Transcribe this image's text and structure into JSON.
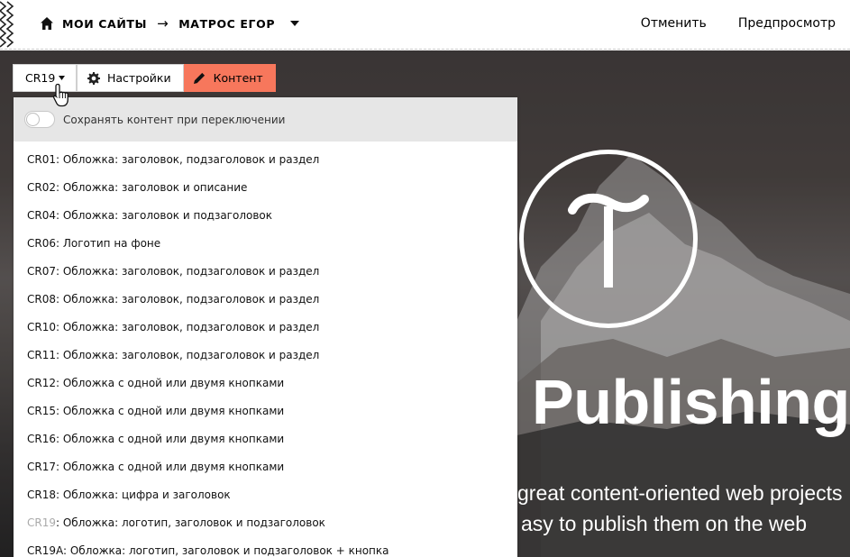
{
  "header": {
    "breadcrumb": {
      "root": "Мои сайты",
      "arrow": "→",
      "current": "Матрос Егор"
    },
    "actions": {
      "cancel": "Отменить",
      "preview": "Предпросмотр"
    }
  },
  "toolbar": {
    "block_code": "CR19",
    "settings_label": "Настройки",
    "content_label": "Контент",
    "content_accent": "#f7775c"
  },
  "dropdown": {
    "toggle_label": "Сохранять контент при переключении",
    "toggle_on": false,
    "items": [
      {
        "code": "CR01",
        "label": ": Обложка: заголовок, подзаголовок и раздел"
      },
      {
        "code": "CR02",
        "label": ": Обложка: заголовок и описание"
      },
      {
        "code": "CR04",
        "label": ": Обложка: заголовок и подзаголовок"
      },
      {
        "code": "CR06",
        "label": ": Логотип на фоне"
      },
      {
        "code": "CR07",
        "label": ": Обложка: заголовок, подзаголовок и раздел"
      },
      {
        "code": "CR08",
        "label": ": Обложка: заголовок, подзаголовок и раздел"
      },
      {
        "code": "CR10",
        "label": ": Обложка: заголовок, подзаголовок и раздел"
      },
      {
        "code": "CR11",
        "label": ": Обложка: заголовок, подзаголовок и раздел"
      },
      {
        "code": "CR12",
        "label": ": Обложка с одной или двумя кнопками"
      },
      {
        "code": "CR15",
        "label": ": Обложка с одной или двумя кнопками"
      },
      {
        "code": "CR16",
        "label": ": Обложка с одной или двумя кнопками"
      },
      {
        "code": "CR17",
        "label": ": Обложка с одной или двумя кнопками"
      },
      {
        "code": "CR18",
        "label": ": Обложка: цифра и заголовок"
      },
      {
        "code": "CR19",
        "label": ": Обложка: логотип, заголовок и подзаголовок",
        "current": true
      },
      {
        "code": "CR19A",
        "label": ": Обложка: логотип, заголовок и подзаголовок + кнопка"
      }
    ]
  },
  "hero": {
    "title": "Publishing",
    "subtitle_line1": "great content-oriented web projects",
    "subtitle_line2": "asy to publish them on the web"
  },
  "icons": {
    "home": "home-icon",
    "gear": "gear-icon",
    "pencil": "pencil-icon",
    "caret": "chevron-down-icon",
    "cursor": "hand-cursor-icon"
  }
}
